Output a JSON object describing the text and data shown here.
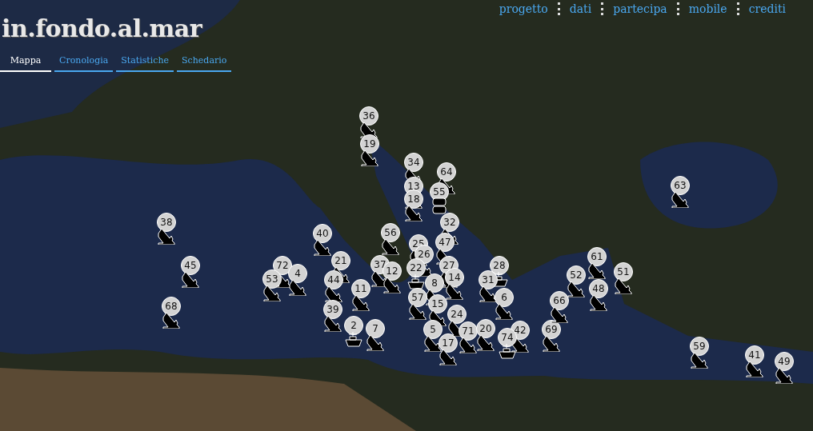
{
  "logo": "in.fondo.al.mar",
  "nav_links": [
    {
      "label": "progetto"
    },
    {
      "label": "dati"
    },
    {
      "label": "partecipa"
    },
    {
      "label": "mobile"
    },
    {
      "label": "crediti"
    }
  ],
  "tabs": [
    {
      "label": "Mappa",
      "selected": true
    },
    {
      "label": "Cronologia",
      "selected": false
    },
    {
      "label": "Statistiche",
      "selected": false
    },
    {
      "label": "Schedario",
      "selected": false
    }
  ],
  "markers": [
    {
      "label": "36",
      "kind": "wreck"
    },
    {
      "label": "19",
      "kind": "wreck"
    },
    {
      "label": "34",
      "kind": "wreck"
    },
    {
      "label": "64",
      "kind": "wreck"
    },
    {
      "label": "13",
      "kind": "wreck"
    },
    {
      "label": "55",
      "kind": "barrels"
    },
    {
      "label": "18",
      "kind": "wreck"
    },
    {
      "label": "32",
      "kind": "wreck"
    },
    {
      "label": "38",
      "kind": "wreck"
    },
    {
      "label": "40",
      "kind": "wreck"
    },
    {
      "label": "56",
      "kind": "wreck"
    },
    {
      "label": "25",
      "kind": "wreck"
    },
    {
      "label": "47",
      "kind": "wreck"
    },
    {
      "label": "26",
      "kind": "wreck"
    },
    {
      "label": "45",
      "kind": "wreck"
    },
    {
      "label": "72",
      "kind": "wreck"
    },
    {
      "label": "21",
      "kind": "wreck"
    },
    {
      "label": "37",
      "kind": "wreck"
    },
    {
      "label": "12",
      "kind": "wreck"
    },
    {
      "label": "22",
      "kind": "ship"
    },
    {
      "label": "27",
      "kind": "wreck"
    },
    {
      "label": "28",
      "kind": "ship"
    },
    {
      "label": "53",
      "kind": "wreck"
    },
    {
      "label": "4",
      "kind": "wreck"
    },
    {
      "label": "44",
      "kind": "wreck"
    },
    {
      "label": "14",
      "kind": "wreck"
    },
    {
      "label": "31",
      "kind": "wreck"
    },
    {
      "label": "11",
      "kind": "wreck"
    },
    {
      "label": "8",
      "kind": "wreck"
    },
    {
      "label": "57",
      "kind": "wreck"
    },
    {
      "label": "6",
      "kind": "wreck"
    },
    {
      "label": "15",
      "kind": "wreck"
    },
    {
      "label": "24",
      "kind": "wreck"
    },
    {
      "label": "68",
      "kind": "wreck"
    },
    {
      "label": "39",
      "kind": "wreck"
    },
    {
      "label": "2",
      "kind": "ship"
    },
    {
      "label": "7",
      "kind": "wreck"
    },
    {
      "label": "5",
      "kind": "wreck"
    },
    {
      "label": "71",
      "kind": "wreck"
    },
    {
      "label": "20",
      "kind": "wreck"
    },
    {
      "label": "42",
      "kind": "wreck"
    },
    {
      "label": "74",
      "kind": "ship"
    },
    {
      "label": "69",
      "kind": "wreck"
    },
    {
      "label": "17",
      "kind": "wreck"
    },
    {
      "label": "61",
      "kind": "wreck"
    },
    {
      "label": "52",
      "kind": "wreck"
    },
    {
      "label": "51",
      "kind": "wreck"
    },
    {
      "label": "48",
      "kind": "wreck"
    },
    {
      "label": "66",
      "kind": "wreck"
    },
    {
      "label": "59",
      "kind": "wreck"
    },
    {
      "label": "41",
      "kind": "wreck"
    },
    {
      "label": "49",
      "kind": "wreck"
    },
    {
      "label": "63",
      "kind": "wreck"
    }
  ]
}
